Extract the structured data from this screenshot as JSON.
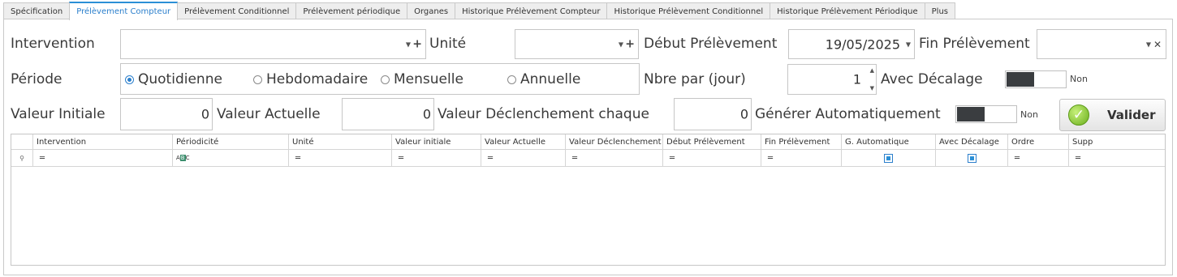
{
  "tabs": [
    {
      "label": "Spécification",
      "active": false
    },
    {
      "label": "Prélèvement Compteur",
      "active": true
    },
    {
      "label": "Prélèvement Conditionnel",
      "active": false
    },
    {
      "label": "Prélèvement périodique",
      "active": false
    },
    {
      "label": "Organes",
      "active": false
    },
    {
      "label": "Historique Prélèvement Compteur",
      "active": false
    },
    {
      "label": "Historique Prélèvement Conditionnel",
      "active": false
    },
    {
      "label": "Historique Prélèvement Périodique",
      "active": false
    },
    {
      "label": "Plus",
      "active": false
    }
  ],
  "form": {
    "intervention": {
      "label": "Intervention",
      "value": ""
    },
    "unite": {
      "label": "Unité",
      "value": ""
    },
    "debut_prelevement": {
      "label": "Début Prélèvement",
      "value": "19/05/2025"
    },
    "fin_prelevement": {
      "label": "Fin Prélèvement",
      "value": ""
    },
    "periode": {
      "label": "Période",
      "options": [
        "Quotidienne",
        "Hebdomadaire",
        "Mensuelle",
        "Annuelle"
      ],
      "selected": "Quotidienne"
    },
    "nbre_par_jour": {
      "label": "Nbre  par (jour)",
      "value": "1"
    },
    "avec_decalage": {
      "label": "Avec Décalage",
      "state": "Non"
    },
    "valeur_initiale": {
      "label": "Valeur Initiale",
      "value": "0"
    },
    "valeur_actuelle": {
      "label": "Valeur Actuelle",
      "value": "0"
    },
    "valeur_declenchement": {
      "label": "Valeur Déclenchement chaque",
      "value": "0"
    },
    "generer_auto": {
      "label": "Générer Automatiquement",
      "state": "Non"
    },
    "valider_label": "Valider"
  },
  "grid": {
    "columns": [
      "Intervention",
      "Périodicité",
      "Unité",
      "Valeur initiale",
      "Valeur Actuelle",
      "Valeur Déclenchement",
      "Début Prélèvement",
      "Fin Prélèvement",
      "G. Automatique",
      "Avec Décalage",
      "Ordre",
      "Supp"
    ],
    "rows": []
  },
  "icons": {
    "dropdown": "chevron-down-icon",
    "add": "plus-icon",
    "clear": "close-icon",
    "valider": "check-circle-icon",
    "filter_pin": "pin-icon"
  },
  "colors": {
    "active_tab": "#2b8fd6",
    "toggle_knob": "#3a3d40",
    "check_green": "#6aae1c"
  }
}
